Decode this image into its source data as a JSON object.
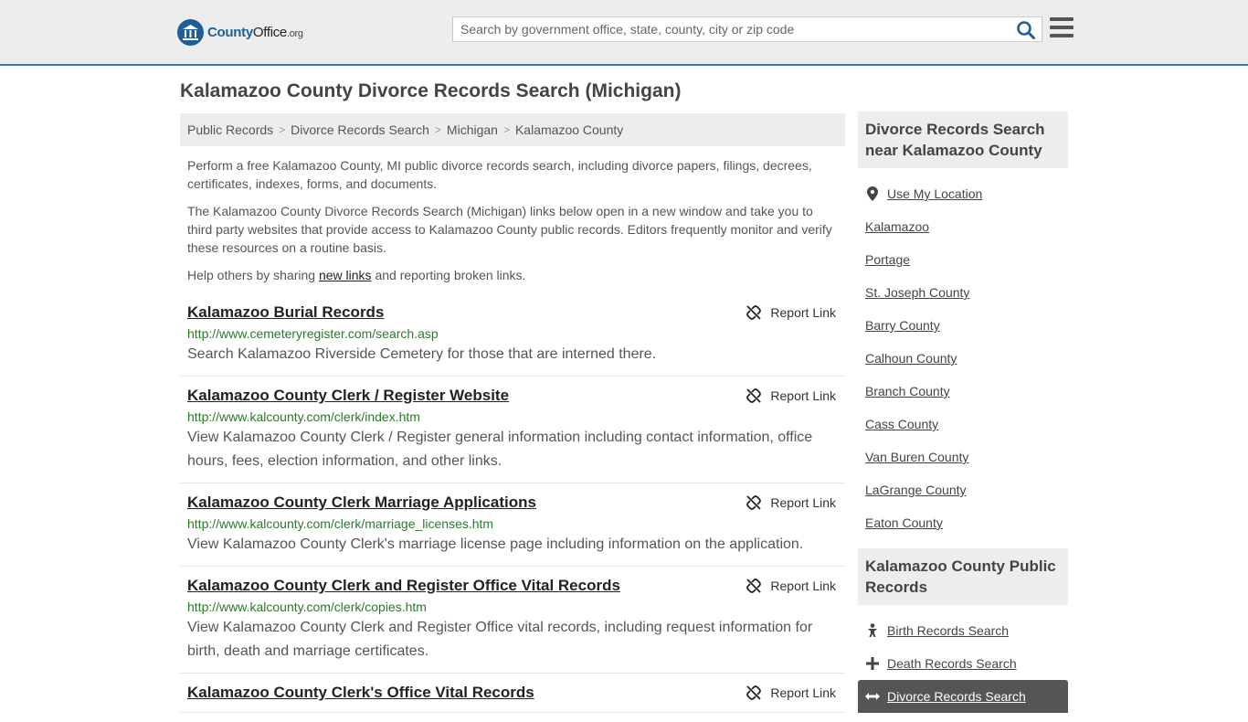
{
  "header": {
    "logo": {
      "brand_bold": "County",
      "brand_rest": "Office",
      "brand_tld": ".org"
    },
    "search": {
      "placeholder": "Search by government office, state, county, city or zip code",
      "value": ""
    }
  },
  "page": {
    "title": "Kalamazoo County Divorce Records Search (Michigan)"
  },
  "breadcrumb": [
    "Public Records",
    "Divorce Records Search",
    "Michigan",
    "Kalamazoo County"
  ],
  "intro": {
    "p1": "Perform a free Kalamazoo County, MI public divorce records search, including divorce papers, filings, decrees, certificates, indexes, forms, and documents.",
    "p2": "The Kalamazoo County Divorce Records Search (Michigan) links below open in a new window and take you to third party websites that provide access to Kalamazoo County public records. Editors frequently monitor and verify these resources on a routine basis.",
    "p3_before": "Help others by sharing ",
    "p3_link": "new links",
    "p3_after": " and reporting broken links."
  },
  "report_label": "Report Link",
  "results": [
    {
      "title": "Kalamazoo Burial Records",
      "url": "http://www.cemeteryregister.com/search.asp",
      "desc": "Search Kalamazoo Riverside Cemetery for those that are interned there."
    },
    {
      "title": "Kalamazoo County Clerk / Register Website",
      "url": "http://www.kalcounty.com/clerk/index.htm",
      "desc": "View Kalamazoo County Clerk / Register general information including contact information, office hours, fees, election information, and other links."
    },
    {
      "title": "Kalamazoo County Clerk Marriage Applications",
      "url": "http://www.kalcounty.com/clerk/marriage_licenses.htm",
      "desc": "View Kalamazoo County Clerk's marriage license page including information on the application."
    },
    {
      "title": "Kalamazoo County Clerk and Register Office Vital Records",
      "url": "http://www.kalcounty.com/clerk/copies.htm",
      "desc": "View Kalamazoo County Clerk and Register Office vital records, including request information for birth, death and marriage certificates."
    },
    {
      "title": "Kalamazoo County Clerk's Office Vital Records",
      "url": "",
      "desc": ""
    }
  ],
  "sidebar": {
    "nearby_heading": "Divorce Records Search near Kalamazoo County",
    "use_location": "Use My Location",
    "nearby": [
      "Kalamazoo",
      "Portage",
      "St. Joseph County",
      "Barry County",
      "Calhoun County",
      "Branch County",
      "Cass County",
      "Van Buren County",
      "LaGrange County",
      "Eaton County"
    ],
    "public_heading": "Kalamazoo County Public Records",
    "public_items": [
      {
        "label": "Birth Records Search",
        "icon": "baby-icon"
      },
      {
        "label": "Death Records Search",
        "icon": "cross-icon"
      },
      {
        "label": "Divorce Records Search",
        "icon": "split-arrows-icon"
      }
    ]
  },
  "colors": {
    "brand_blue": "#1f5f97",
    "url_green": "#2a7a2a",
    "header_bg": "#ededed"
  }
}
